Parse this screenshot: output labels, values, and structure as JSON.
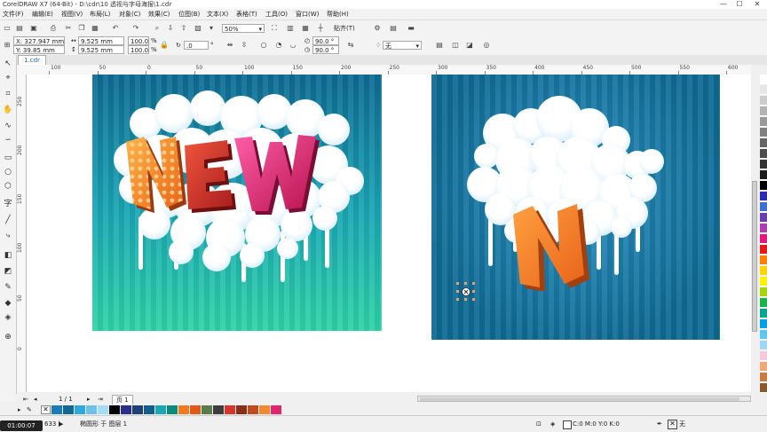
{
  "titlebar": {
    "title": "CorelDRAW X7 (64-Bit) - D:\\cdr\\10 透视与字母海报\\1.cdr",
    "minimize": "—",
    "maximize": "☐",
    "close": "✕"
  },
  "menubar": {
    "items": [
      "文件(F)",
      "编辑(E)",
      "视图(V)",
      "布局(L)",
      "对象(C)",
      "效果(C)",
      "位图(B)",
      "文本(X)",
      "表格(T)",
      "工具(O)",
      "窗口(W)",
      "帮助(H)"
    ]
  },
  "toolbar": {
    "zoom": "50%",
    "snap_label": "贴齐(T)"
  },
  "propbar": {
    "x_value": "X: 327.947 mm",
    "y_value": "Y: 39.85 mm",
    "width_value": "9.525 mm",
    "height_value": "9.525 mm",
    "scale_x": "100.0",
    "scale_y": "100.0",
    "pct": "%",
    "rotation": ".0",
    "degree": "°",
    "start_angle": "90.0 °",
    "end_angle": "90.0 °",
    "outline_none": "无"
  },
  "document": {
    "tab_label": "1.cdr"
  },
  "hruler": {
    "labels": [
      "100",
      "50",
      "0",
      "50",
      "100",
      "150",
      "200",
      "250",
      "300",
      "350",
      "400",
      "450",
      "500",
      "550",
      "600"
    ]
  },
  "vruler": {
    "labels": [
      "250",
      "200",
      "150",
      "100",
      "50",
      "0"
    ]
  },
  "pagenav": {
    "page_count": "1 / 1",
    "page_tab": "页 1"
  },
  "statusbar": {
    "coords": "633 )",
    "object_info": "椭圆形 于 图层 1",
    "fill_info": "C:0 M:0 Y:0 K:0",
    "outline_info": "无",
    "timer": "01:00:07"
  },
  "artwork": {
    "left_text": "NEW",
    "right_letter": "N",
    "colors": {
      "bg_dark": "#0e6a93",
      "bg_teal": "#1aa7b5",
      "bg_green": "#2fd3a6",
      "letter_orange": "#f07a1d",
      "letter_red": "#d9332a",
      "letter_pink": "#e2266e"
    }
  },
  "palette": {
    "colors": [
      "#ffffff",
      "#e6e6e6",
      "#cccccc",
      "#b3b3b3",
      "#999999",
      "#808080",
      "#666666",
      "#4d4d4d",
      "#333333",
      "#1a1a1a",
      "#000000",
      "#2b2bb0",
      "#3d6fd1",
      "#6a3db0",
      "#b03db0",
      "#e01a7b",
      "#e61919",
      "#ff7f00",
      "#ffd400",
      "#fff200",
      "#a6d608",
      "#19b24b",
      "#00a68f",
      "#00a0e6",
      "#5ac8f0",
      "#9fd8f5",
      "#f5c8dc",
      "#f0a878",
      "#c97c3c",
      "#8b5a2b"
    ]
  },
  "docpalette": {
    "colors": [
      "#1b7ab8",
      "#0e6a93",
      "#2fa9d8",
      "#6cc2e8",
      "#a5dcf1",
      "#000000",
      "#2d2d8c",
      "#1f3f7a",
      "#12608a",
      "#1aa7b5",
      "#0c8a7d",
      "#f07a1d",
      "#e05a1a",
      "#5b7b4b",
      "#3d3d3d",
      "#d9332a",
      "#8a2d1a",
      "#c44a1a",
      "#f08a30",
      "#e2266e"
    ]
  }
}
